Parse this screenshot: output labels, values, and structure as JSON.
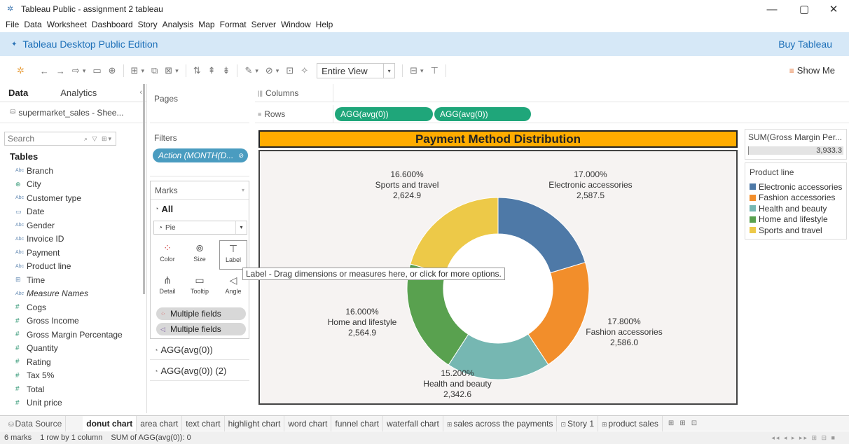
{
  "window": {
    "title": "Tableau Public - assignment 2 tableau",
    "minimize": "—",
    "maximize": "▢",
    "close": "✕"
  },
  "menu": [
    "File",
    "Data",
    "Worksheet",
    "Dashboard",
    "Story",
    "Analysis",
    "Map",
    "Format",
    "Server",
    "Window",
    "Help"
  ],
  "edition": {
    "title": "Tableau Desktop Public Edition",
    "buy": "Buy Tableau"
  },
  "toolbar": {
    "view_select": "Entire View",
    "show_me": "Show Me"
  },
  "datapane": {
    "tab_data": "Data",
    "tab_analytics": "Analytics",
    "datasource": "supermarket_sales - Shee...",
    "search_placeholder": "Search",
    "tables_label": "Tables",
    "fields": [
      {
        "type": "Abc",
        "name": "Branch"
      },
      {
        "type": "geo",
        "name": "City"
      },
      {
        "type": "Abc",
        "name": "Customer type"
      },
      {
        "type": "date",
        "name": "Date"
      },
      {
        "type": "Abc",
        "name": "Gender"
      },
      {
        "type": "Abc",
        "name": "Invoice ID"
      },
      {
        "type": "Abc",
        "name": "Payment"
      },
      {
        "type": "Abc",
        "name": "Product line"
      },
      {
        "type": "time",
        "name": "Time"
      },
      {
        "type": "Abc",
        "name": "Measure Names"
      },
      {
        "type": "#",
        "name": "Cogs"
      },
      {
        "type": "#",
        "name": "Gross Income"
      },
      {
        "type": "#",
        "name": "Gross Margin Percentage"
      },
      {
        "type": "#",
        "name": "Quantity"
      },
      {
        "type": "#",
        "name": "Rating"
      },
      {
        "type": "#",
        "name": "Tax 5%"
      },
      {
        "type": "#",
        "name": "Total"
      },
      {
        "type": "#",
        "name": "Unit price"
      }
    ]
  },
  "cards": {
    "pages": "Pages",
    "filters": "Filters",
    "filter_pill": "Action (MONTH(D...",
    "marks": "Marks",
    "marks_all": "All",
    "mark_type": "Pie",
    "buttons": {
      "color": "Color",
      "size": "Size",
      "label": "Label",
      "detail": "Detail",
      "tooltip": "Tooltip",
      "angle": "Angle"
    },
    "pill_multiple_1": "Multiple fields",
    "pill_multiple_2": "Multiple fields",
    "agg_1": "AGG(avg(0))",
    "agg_2": "AGG(avg(0)) (2)"
  },
  "shelves": {
    "columns": "Columns",
    "rows": "Rows",
    "row_pill_1": "AGG(avg(0))",
    "row_pill_2": "AGG(avg(0))"
  },
  "tooltip": "Label - Drag dimensions or measures here, or click for more options.",
  "right": {
    "sum_title": "SUM(Gross Margin Per...",
    "sum_value": "3,933.3",
    "legend_title": "Product line"
  },
  "chart_data": {
    "type": "pie",
    "subtype": "donut",
    "title": "Payment Method Distribution",
    "categories": [
      "Electronic accessories",
      "Fashion accessories",
      "Health and beauty",
      "Home and lifestyle",
      "Sports and travel"
    ],
    "percent_labels": [
      "17.000%",
      "17.800%",
      "15.200%",
      "16.000%",
      "16.600%"
    ],
    "value_labels": [
      "2,587.5",
      "2,586.0",
      "2,342.6",
      "2,564.9",
      "2,624.9"
    ],
    "values": [
      2587.5,
      2586.0,
      2342.6,
      2564.9,
      2624.9
    ],
    "colors": [
      "#4e79a7",
      "#f28e2b",
      "#76b7b2",
      "#59a14f",
      "#edc948"
    ],
    "legend": "right"
  },
  "tabs": {
    "datasource": "Data Source",
    "sheets": [
      "donut chart",
      "area chart",
      "text chart",
      "highlight chart",
      "word chart",
      "funnel chart",
      "waterfall chart",
      "sales across the payments",
      "Story 1",
      "product sales"
    ]
  },
  "status": {
    "marks": "6 marks",
    "rows": "1 row by 1 column",
    "sum": "SUM of AGG(avg(0)): 0"
  }
}
